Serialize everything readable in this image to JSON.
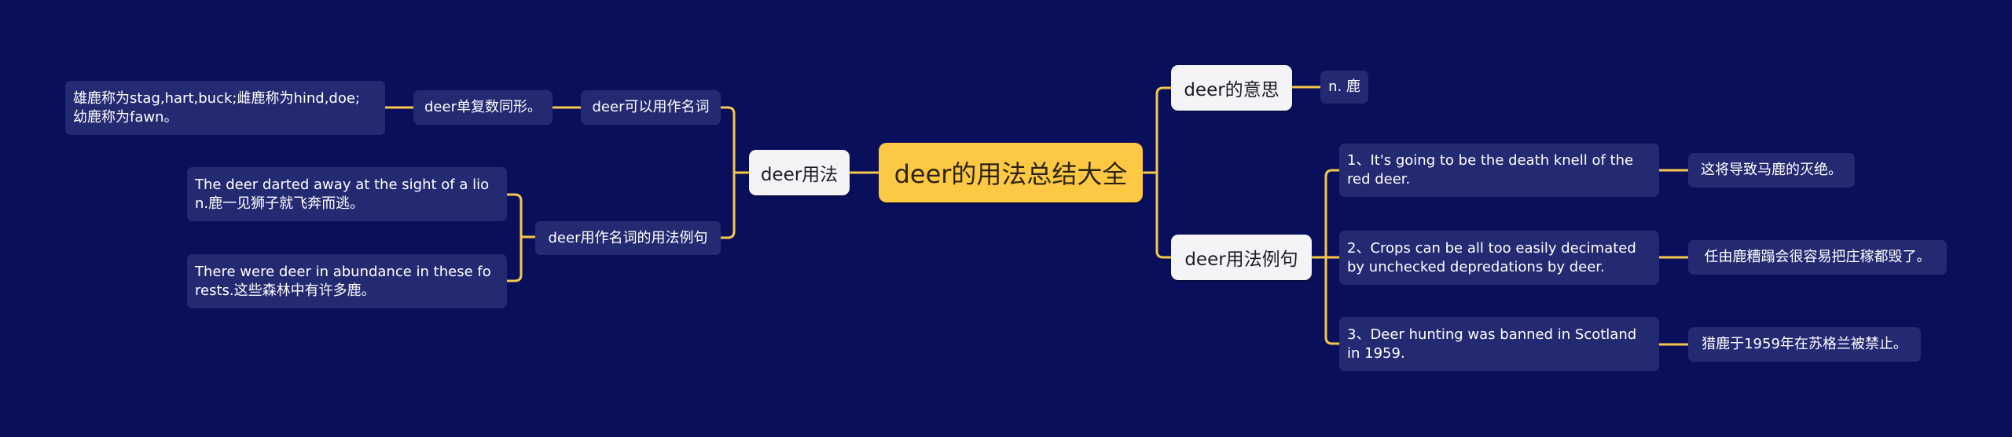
{
  "theme": {
    "background": "#0a0f5c",
    "root_color": "#fdc843",
    "branch_color": "#f4f4f6",
    "leaf_color": "#242a72",
    "line_color": "#f5c84c"
  },
  "root": {
    "label": "deer的用法总结大全"
  },
  "left": {
    "branch": {
      "label": "deer用法"
    },
    "children": [
      {
        "label": "deer可以用作名词",
        "children": [
          {
            "label": "deer单复数同形。",
            "children": [
              {
                "label": "雄鹿称为stag,hart,buck;雌鹿称为hind,doe;\n幼鹿称为fawn。"
              }
            ]
          }
        ]
      },
      {
        "label": "deer用作名词的用法例句",
        "children": [
          {
            "label": "The deer darted away at the sight of a lio\nn.鹿一见狮子就飞奔而逃。"
          },
          {
            "label": "There were deer in abundance in these fo\nrests.这些森林中有许多鹿。"
          }
        ]
      }
    ]
  },
  "right": {
    "branches": [
      {
        "label": "deer的意思",
        "children": [
          {
            "label": "n. 鹿"
          }
        ]
      },
      {
        "label": "deer用法例句",
        "children": [
          {
            "label": "1、It's going to be the death knell of the\nred deer.",
            "translation": "这将导致马鹿的灭绝。"
          },
          {
            "label": "2、Crops can be all too easily decimated\nby unchecked depredations by deer.",
            "translation": "任由鹿糟蹋会很容易把庄稼都毁了。"
          },
          {
            "label": "3、Deer hunting was banned in Scotland\nin 1959.",
            "translation": "猎鹿于1959年在苏格兰被禁止。"
          }
        ]
      }
    ]
  }
}
